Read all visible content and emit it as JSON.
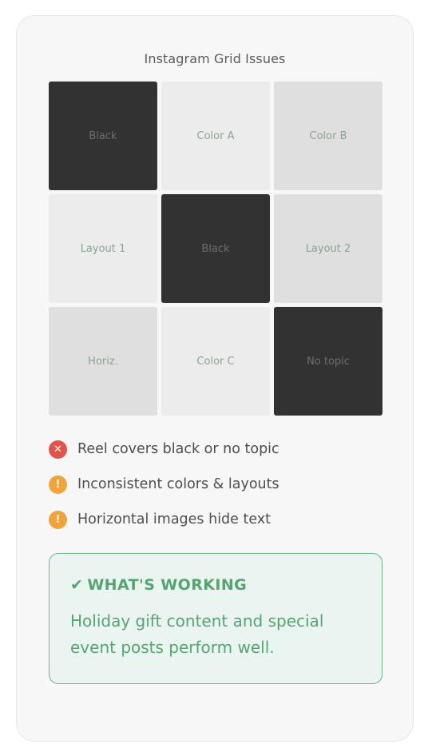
{
  "title": "Instagram Grid Issues",
  "grid": [
    {
      "label": "Black",
      "tone": "black"
    },
    {
      "label": "Color A",
      "tone": "light"
    },
    {
      "label": "Color B",
      "tone": "mid"
    },
    {
      "label": "Layout 1",
      "tone": "light"
    },
    {
      "label": "Black",
      "tone": "black"
    },
    {
      "label": "Layout 2",
      "tone": "mid"
    },
    {
      "label": "Horiz.",
      "tone": "mid"
    },
    {
      "label": "Color C",
      "tone": "light"
    },
    {
      "label": "No topic",
      "tone": "black"
    }
  ],
  "issues": [
    {
      "icon": "x-circle-icon",
      "glyph": "✕",
      "text": "Reel covers black or no topic"
    },
    {
      "icon": "exclamation-circle-icon",
      "glyph": "!",
      "text": "Inconsistent colors & layouts"
    },
    {
      "icon": "exclamation-circle-icon",
      "glyph": "!",
      "text": "Horizontal images hide text"
    }
  ],
  "working": {
    "check": "✔",
    "heading": "WHAT'S WORKING",
    "body": "Holiday gift content and special event posts perform well."
  },
  "colors": {
    "black_tile": "#323232",
    "light_tile": "#ececec",
    "mid_tile": "#dfdfdf",
    "error": "#e2534a",
    "warning": "#f0a43a",
    "working_accent": "#56a471",
    "working_bg": "#eaf4f1"
  }
}
